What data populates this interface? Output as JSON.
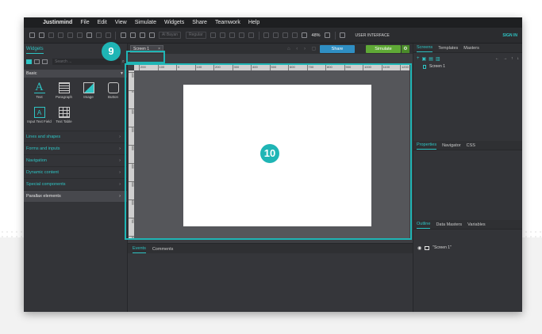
{
  "menubar": {
    "apple": "",
    "app_name": "Justinmind",
    "items": [
      "File",
      "Edit",
      "View",
      "Simulate",
      "Widgets",
      "Share",
      "Teamwork",
      "Help"
    ]
  },
  "toolbar": {
    "font_family": "Al Bayan",
    "font_style": "Regular",
    "zoom": "48%",
    "mode": "USER INTERFACE",
    "sign_in": "SIGN IN"
  },
  "left_panel": {
    "tab": "Widgets",
    "search_placeholder": "Search ...",
    "section": "Basic",
    "widgets": [
      {
        "label": "Text",
        "icon": "text-icon"
      },
      {
        "label": "Paragraph",
        "icon": "paragraph-icon"
      },
      {
        "label": "Image",
        "icon": "image-icon"
      },
      {
        "label": "Button",
        "icon": "button-icon"
      },
      {
        "label": "Input Text Field",
        "icon": "input-text-icon"
      },
      {
        "label": "Text Table",
        "icon": "table-icon"
      }
    ],
    "categories": [
      "Lines and shapes",
      "Forms and inputs",
      "Navigation",
      "Dynamic content",
      "Special components",
      "Parallax elements"
    ]
  },
  "center": {
    "screen_tab": "Screen 1",
    "share": "Share",
    "simulate": "Simulate",
    "ruler_top": [
      "200",
      "100",
      "0",
      "100",
      "200",
      "300",
      "400",
      "500",
      "600",
      "700",
      "800",
      "900",
      "1000",
      "1100",
      "1200"
    ],
    "ruler_left": [
      "100",
      "0",
      "100",
      "200",
      "300",
      "400",
      "500",
      "600",
      "700",
      "800"
    ],
    "events_tabs": [
      "Events",
      "Comments"
    ]
  },
  "right_panel": {
    "screens_tabs": [
      "Screens",
      "Templates",
      "Masters"
    ],
    "screen_item": "Screen 1",
    "props_tabs": [
      "Properties",
      "Navigator",
      "CSS"
    ],
    "outline_tabs": [
      "Outline",
      "Data Masters",
      "Variables"
    ],
    "outline_item": "\"Screen 1\""
  },
  "callouts": {
    "tab_number": "9",
    "canvas_number": "10",
    "accent": "#1fb5b5"
  }
}
